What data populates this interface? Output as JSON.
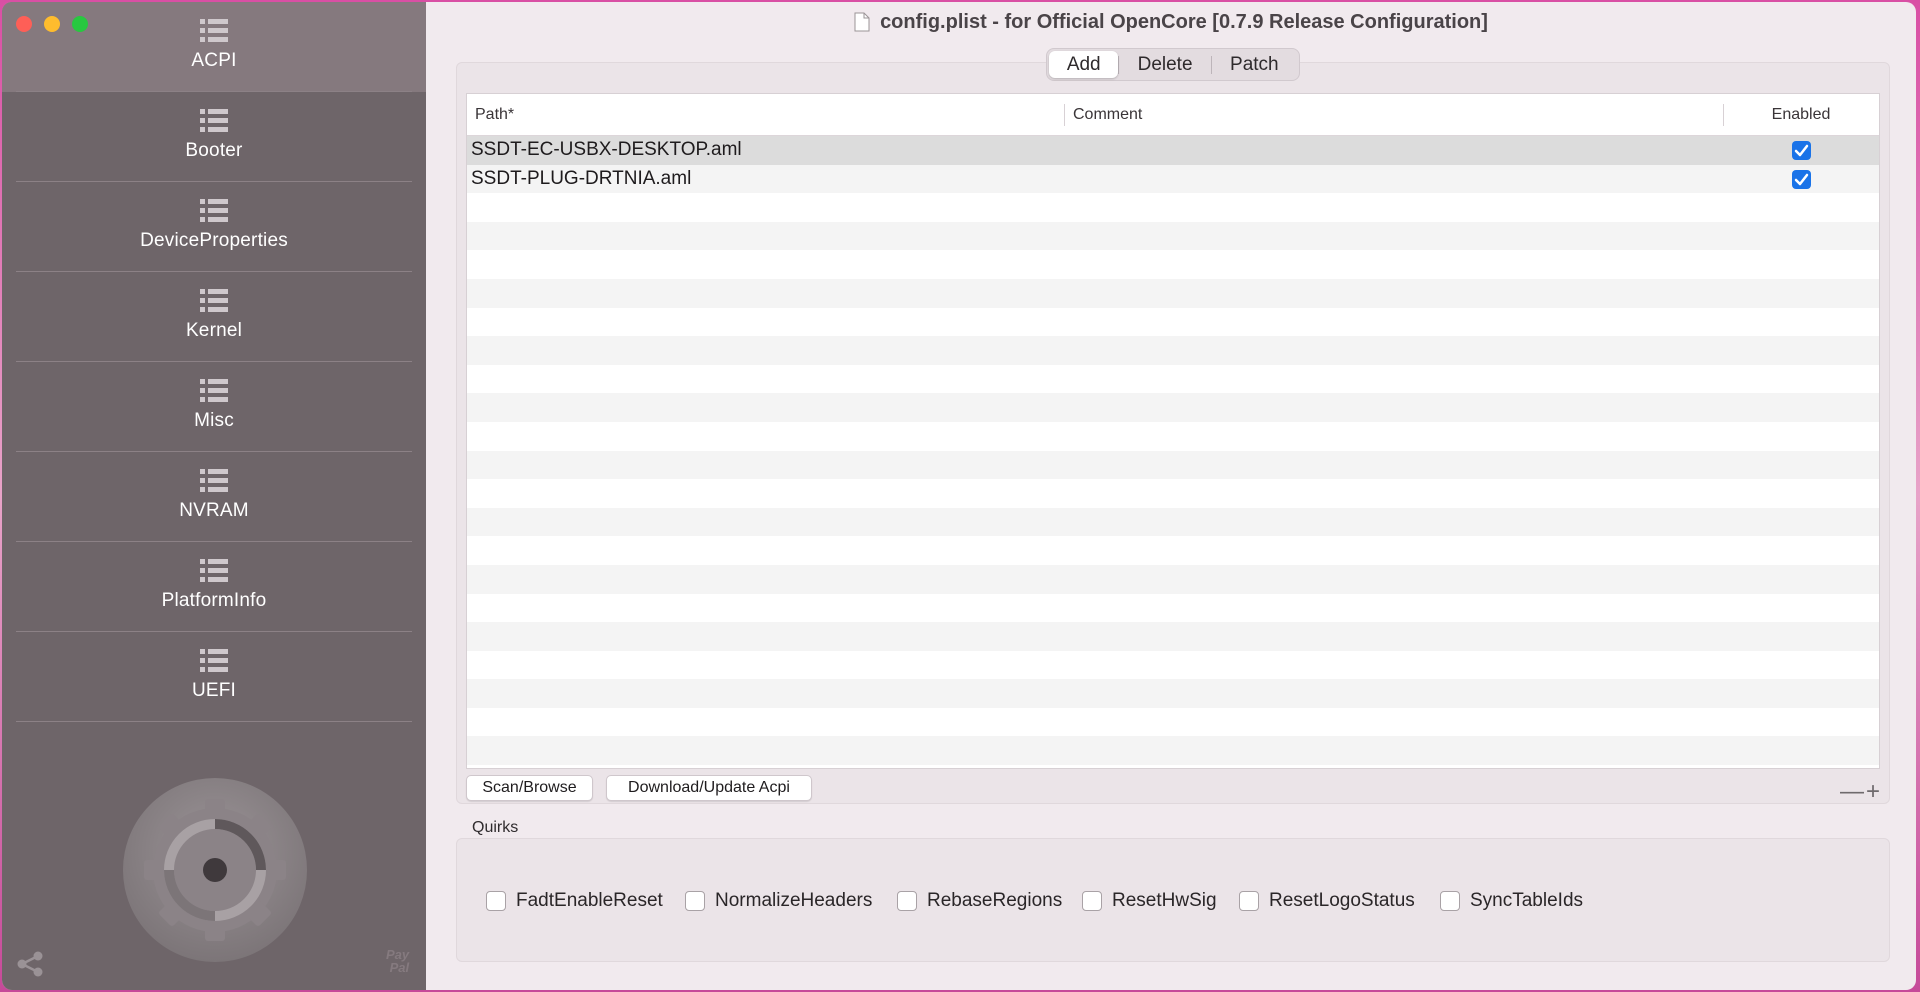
{
  "window": {
    "title": "config.plist - for Official OpenCore [0.7.9 Release Configuration]"
  },
  "sidebar": {
    "items": [
      {
        "label": "ACPI",
        "active": true
      },
      {
        "label": "Booter",
        "active": false
      },
      {
        "label": "DeviceProperties",
        "active": false
      },
      {
        "label": "Kernel",
        "active": false
      },
      {
        "label": "Misc",
        "active": false
      },
      {
        "label": "NVRAM",
        "active": false
      },
      {
        "label": "PlatformInfo",
        "active": false
      },
      {
        "label": "UEFI",
        "active": false
      }
    ],
    "paypal_line1": "Pay",
    "paypal_line2": "Pal"
  },
  "tabs": [
    {
      "label": "Add",
      "active": true
    },
    {
      "label": "Delete",
      "active": false
    },
    {
      "label": "Patch",
      "active": false
    }
  ],
  "table": {
    "columns": [
      "Path*",
      "Comment",
      "Enabled"
    ],
    "rows": [
      {
        "path": "SSDT-EC-USBX-DESKTOP.aml",
        "comment": "",
        "enabled": true
      },
      {
        "path": "SSDT-PLUG-DRTNIA.aml",
        "comment": "",
        "enabled": true
      }
    ]
  },
  "buttons": {
    "scan_browse": "Scan/Browse",
    "download_update": "Download/Update Acpi",
    "minus": "—",
    "plus": "+"
  },
  "quirks": {
    "label": "Quirks",
    "items": [
      {
        "label": "FadtEnableReset",
        "checked": false
      },
      {
        "label": "NormalizeHeaders",
        "checked": false
      },
      {
        "label": "RebaseRegions",
        "checked": false
      },
      {
        "label": "ResetHwSig",
        "checked": false
      },
      {
        "label": "ResetLogoStatus",
        "checked": false
      },
      {
        "label": "SyncTableIds",
        "checked": false
      }
    ]
  },
  "colors": {
    "sidebar_bg": "#6e6569",
    "sidebar_active": "#85797e",
    "checkbox_accent": "#1a73e8",
    "window_bg": "#f1eaee"
  }
}
